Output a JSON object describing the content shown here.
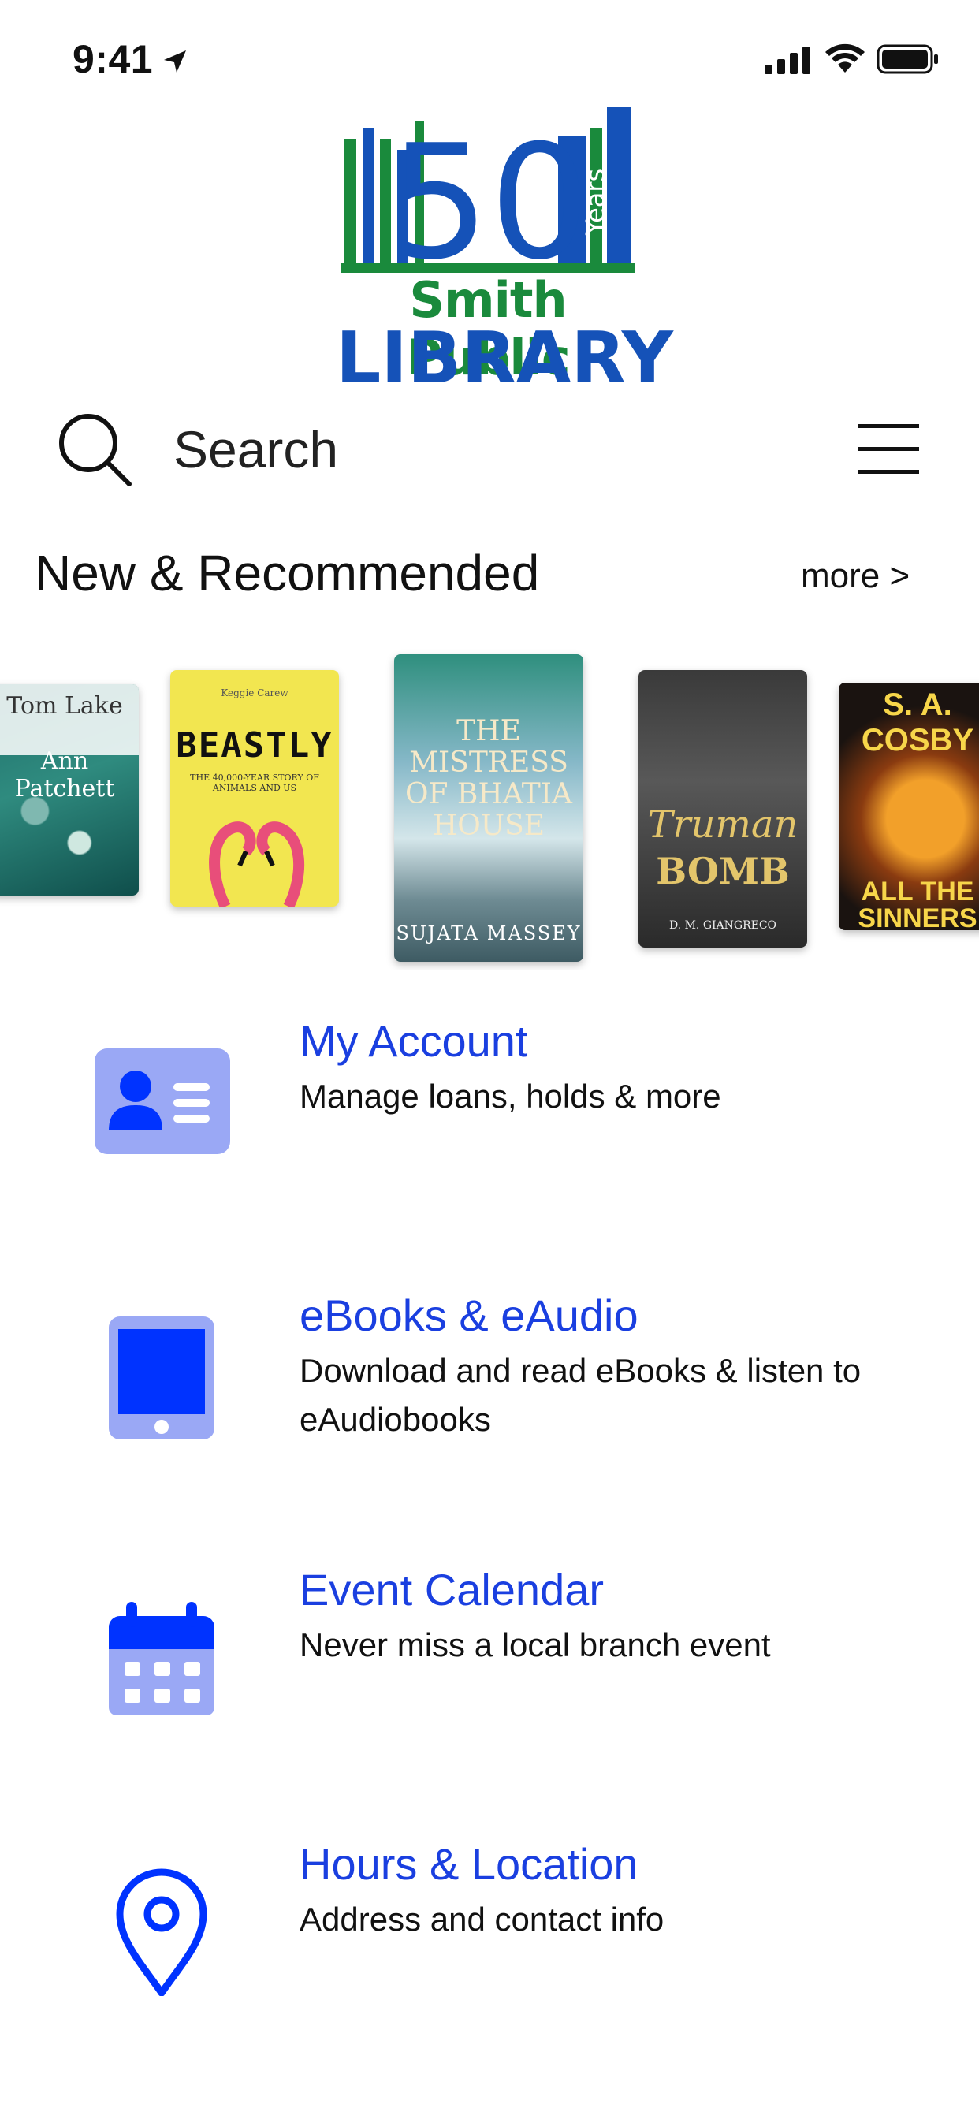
{
  "status_bar": {
    "time": "9:41"
  },
  "logo": {
    "number": "50",
    "years": "Years",
    "line1": "Smith Public",
    "line2": "LIBRARY",
    "colors": {
      "green": "#1a8a3c",
      "blue": "#1552b8"
    }
  },
  "search": {
    "placeholder": "Search"
  },
  "section": {
    "title": "New & Recommended",
    "more_label": "more >"
  },
  "books": [
    {
      "title": "Tom Lake",
      "author": "Ann Patchett"
    },
    {
      "title": "BEASTLY",
      "author": "Keggie Carew",
      "subtitle": "THE 40,000-YEAR STORY OF ANIMALS AND US"
    },
    {
      "title": "THE MISTRESS OF BHATIA HOUSE",
      "author": "SUJATA MASSEY"
    },
    {
      "title": "Truman",
      "title2": "BOMB",
      "author": "D. M. GIANGRECO"
    },
    {
      "title": "ALL THE SINNERS BLEED",
      "author": "S. A. COSBY"
    }
  ],
  "menu": [
    {
      "title": "My Account",
      "description": "Manage loans, holds & more",
      "icon": "account-card-icon"
    },
    {
      "title": "eBooks & eAudio",
      "description": "Download and read eBooks & listen to eAudiobooks",
      "icon": "tablet-icon"
    },
    {
      "title": "Event Calendar",
      "description": "Never miss a local branch event",
      "icon": "calendar-icon"
    },
    {
      "title": "Hours & Location",
      "description": "Address and contact info",
      "icon": "location-pin-icon"
    }
  ],
  "colors": {
    "accent_blue": "#1a3fe0",
    "icon_blue": "#0033ff",
    "icon_light": "#9aa8f5"
  }
}
